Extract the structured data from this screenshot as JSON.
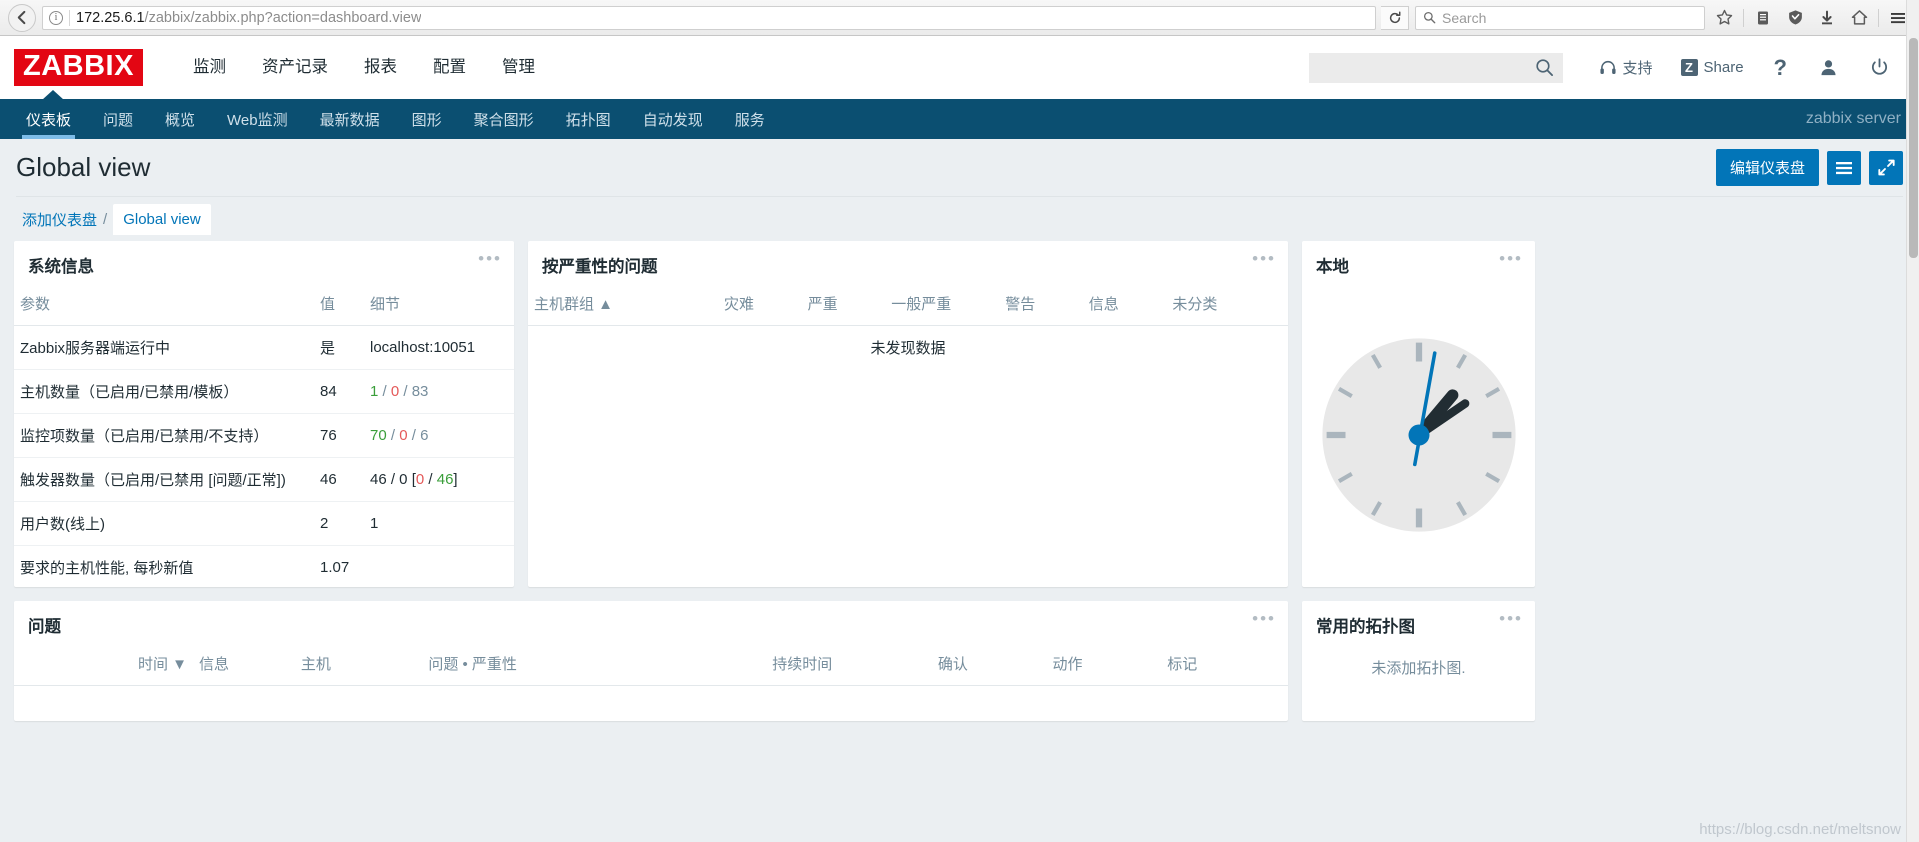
{
  "browser": {
    "url_host": "172.25.6.1",
    "url_path": "/zabbix/zabbix.php?action=dashboard.view",
    "search_placeholder": "Search",
    "icons": {
      "back": "back-arrow-icon",
      "info": "info-icon",
      "reload": "reload-icon",
      "search": "search-icon",
      "bookmark": "star-icon",
      "library": "library-icon",
      "shield": "pocket-icon",
      "downloads": "download-icon",
      "home": "home-icon",
      "menu": "hamburger-menu-icon"
    }
  },
  "header": {
    "logo": "ZABBIX",
    "logo_color": "#e30613",
    "nav": [
      {
        "label": "监测",
        "active": true
      },
      {
        "label": "资产记录",
        "active": false
      },
      {
        "label": "报表",
        "active": false
      },
      {
        "label": "配置",
        "active": false
      },
      {
        "label": "管理",
        "active": false
      }
    ],
    "search_value": "",
    "support_label": "支持",
    "share_label": "Share",
    "share_badge": "Z",
    "help_label": "?"
  },
  "subnav": {
    "items": [
      {
        "label": "仪表板",
        "active": true
      },
      {
        "label": "问题",
        "active": false
      },
      {
        "label": "概览",
        "active": false
      },
      {
        "label": "Web监测",
        "active": false
      },
      {
        "label": "最新数据",
        "active": false
      },
      {
        "label": "图形",
        "active": false
      },
      {
        "label": "聚合图形",
        "active": false
      },
      {
        "label": "拓扑图",
        "active": false
      },
      {
        "label": "自动发现",
        "active": false
      },
      {
        "label": "服务",
        "active": false
      }
    ],
    "server": "zabbix server"
  },
  "page": {
    "title": "Global view",
    "edit_button": "编辑仪表盘",
    "breadcrumb": {
      "add_dashboard": "添加仪表盘",
      "separator": "/",
      "current": "Global view"
    },
    "accent_color": "#0275b8"
  },
  "widgets": {
    "system_info": {
      "title": "系统信息",
      "columns": [
        "参数",
        "值",
        "细节"
      ],
      "rows": [
        {
          "param": "Zabbix服务器端运行中",
          "value": "是",
          "value_color": "#3a9e3a",
          "detail_plain": "localhost:10051"
        },
        {
          "param": "主机数量（已启用/已禁用/模板）",
          "value": "84",
          "detail_parts": [
            {
              "t": "1",
              "c": "green"
            },
            {
              "t": " / ",
              "c": "plain"
            },
            {
              "t": "0",
              "c": "red"
            },
            {
              "t": " / ",
              "c": "plain"
            },
            {
              "t": "83",
              "c": "grey"
            }
          ]
        },
        {
          "param": "监控项数量（已启用/已禁用/不支持）",
          "value": "76",
          "detail_parts": [
            {
              "t": "70",
              "c": "green"
            },
            {
              "t": " / ",
              "c": "plain"
            },
            {
              "t": "0",
              "c": "red"
            },
            {
              "t": " / ",
              "c": "plain"
            },
            {
              "t": "6",
              "c": "grey"
            }
          ]
        },
        {
          "param": "触发器数量（已启用/已禁用 [问题/正常])",
          "value": "46",
          "detail_parts": [
            {
              "t": "46 / 0 [",
              "c": "plain"
            },
            {
              "t": "0",
              "c": "red"
            },
            {
              "t": " / ",
              "c": "plain"
            },
            {
              "t": "46",
              "c": "green"
            },
            {
              "t": "]",
              "c": "plain"
            }
          ]
        },
        {
          "param": "用户数(线上)",
          "value": "2",
          "detail_parts": [
            {
              "t": "1",
              "c": "green"
            }
          ]
        },
        {
          "param": "要求的主机性能, 每秒新值",
          "value": "1.07",
          "detail_plain": ""
        }
      ]
    },
    "problems_by_severity": {
      "title": "按严重性的问题",
      "columns": [
        "主机群组 ▲",
        "灾难",
        "严重",
        "一般严重",
        "警告",
        "信息",
        "未分类"
      ],
      "empty_text": "未发现数据"
    },
    "clock": {
      "title": "本地",
      "hour": 1,
      "minute": 7,
      "second": 58,
      "hand_color": "#0275b8",
      "face_color": "#e8e8e8"
    },
    "problems": {
      "title": "问题",
      "columns": [
        "时间 ▼",
        "信息",
        "主机",
        "问题 • 严重性",
        "持续时间",
        "确认",
        "动作",
        "标记"
      ]
    },
    "favourite_maps": {
      "title": "常用的拓扑图",
      "empty_text": "未添加拓扑图."
    }
  },
  "watermark": "https://blog.csdn.net/meltsnow"
}
